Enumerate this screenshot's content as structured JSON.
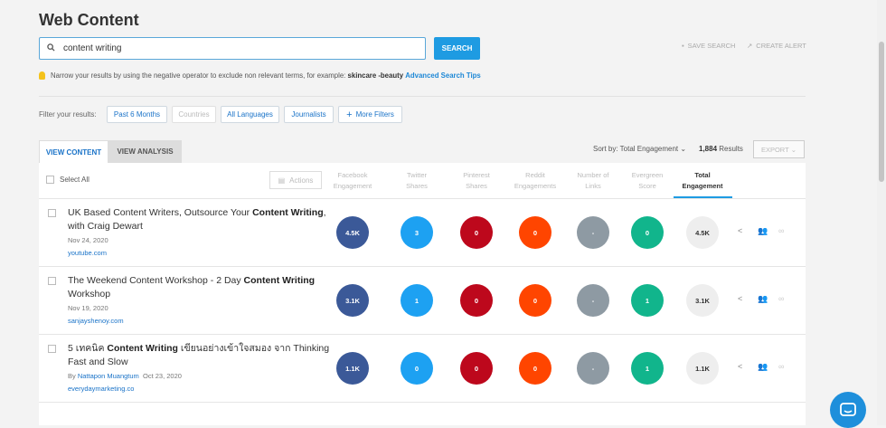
{
  "page": {
    "title": "Web Content"
  },
  "search": {
    "value": "content writing",
    "button_label": "SEARCH",
    "save_label": "SAVE SEARCH",
    "alert_label": "CREATE ALERT"
  },
  "tip": {
    "text": "Narrow your results by using the negative operator to exclude non relevant terms, for example:",
    "example": "skincare -beauty",
    "link": "Advanced Search Tips"
  },
  "filters": {
    "label": "Filter your results:",
    "chips": [
      {
        "label": "Past 6 Months",
        "enabled": true
      },
      {
        "label": "Countries",
        "enabled": false
      },
      {
        "label": "All Languages",
        "enabled": true
      },
      {
        "label": "Journalists",
        "enabled": true
      },
      {
        "label": "More Filters",
        "enabled": true
      }
    ]
  },
  "tabs": {
    "view_content": "VIEW CONTENT",
    "view_analysis": "VIEW ANALYSIS"
  },
  "sort": {
    "label": "Sort by: Total Engagement"
  },
  "results": {
    "count": "1,884",
    "suffix": " Results"
  },
  "export_label": "EXPORT",
  "table": {
    "select_all": "Select All",
    "actions_label": "Actions",
    "columns": [
      {
        "line1": "Facebook",
        "line2": "Engagement"
      },
      {
        "line1": "Twitter",
        "line2": "Shares"
      },
      {
        "line1": "Pinterest",
        "line2": "Shares"
      },
      {
        "line1": "Reddit",
        "line2": "Engagements"
      },
      {
        "line1": "Number of",
        "line2": "Links"
      },
      {
        "line1": "Evergreen",
        "line2": "Score"
      },
      {
        "line1": "Total",
        "line2": "Engagement"
      }
    ],
    "colors": {
      "facebook": "#3b5998",
      "twitter": "#1da1f2",
      "pinterest": "#bd081c",
      "reddit": "#ff4500",
      "links": "#8e9aa3",
      "evergreen": "#11b58c",
      "total": "#eeeeee"
    },
    "rows": [
      {
        "title_pre": "UK Based Content Writers, Outsource Your ",
        "title_bold": "Content Writing",
        "title_post": ", with Craig Dewart",
        "author_prefix": "",
        "author": "",
        "date": "Nov 24, 2020",
        "domain": "youtube.com",
        "metrics": [
          "4.5K",
          "3",
          "0",
          "0",
          "-",
          "0",
          "4.5K"
        ]
      },
      {
        "title_pre": "The Weekend Content Workshop - 2 Day ",
        "title_bold": "Content Writing",
        "title_post": " Workshop",
        "author_prefix": "",
        "author": "",
        "date": "Nov 19, 2020",
        "domain": "sanjayshenoy.com",
        "metrics": [
          "3.1K",
          "1",
          "0",
          "0",
          "-",
          "1",
          "3.1K"
        ]
      },
      {
        "title_pre": "5 เทคนิค ",
        "title_bold": "Content Writing",
        "title_post": " เขียนอย่างเข้าใจสมอง จาก Thinking Fast and Slow",
        "author_prefix": "By ",
        "author": "Nattapon Muangtum",
        "date": "Oct 23, 2020",
        "domain": "everydaymarketing.co",
        "metrics": [
          "1.1K",
          "0",
          "0",
          "0",
          "-",
          "1",
          "1.1K"
        ]
      }
    ]
  }
}
